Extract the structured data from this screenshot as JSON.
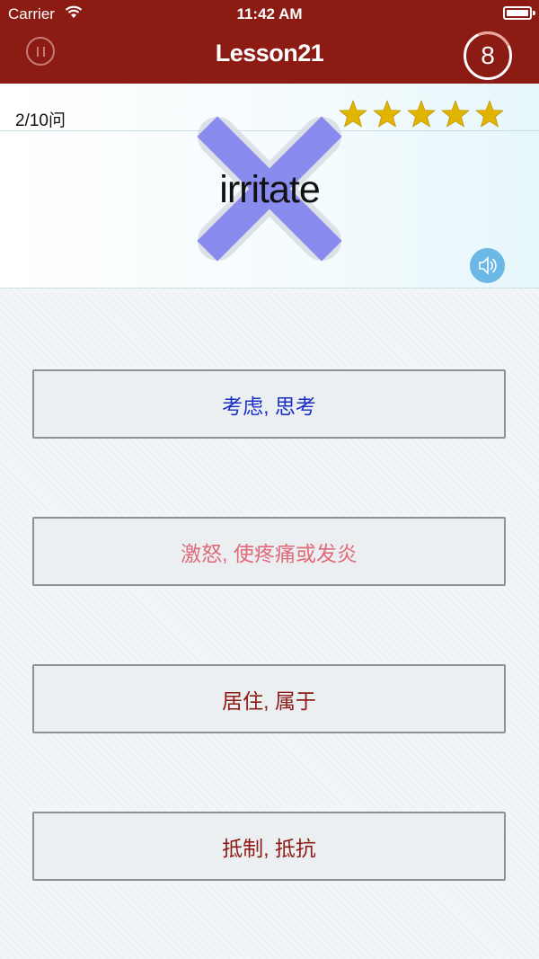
{
  "status_bar": {
    "carrier": "Carrier",
    "time": "11:42 AM"
  },
  "nav": {
    "title": "Lesson21",
    "timer": "8"
  },
  "question": {
    "count": "2/10问",
    "word": "irritate",
    "stars_rating": 5
  },
  "answers": [
    {
      "label": "考虑, 思考",
      "color": "#1a2fc7"
    },
    {
      "label": "激怒, 使疼痛或发炎",
      "color": "#e06a7a"
    },
    {
      "label": "居住, 属于",
      "color": "#8c1b14"
    },
    {
      "label": "抵制, 抵抗",
      "color": "#8c1b14"
    }
  ],
  "colors": {
    "nav_bg": "#8c1b14",
    "star": "#e0b400",
    "speaker": "#6bb7e6"
  },
  "icons": [
    "wifi-icon",
    "battery-icon",
    "pause-icon",
    "star-icon",
    "wrong-x-icon",
    "speaker-icon"
  ]
}
